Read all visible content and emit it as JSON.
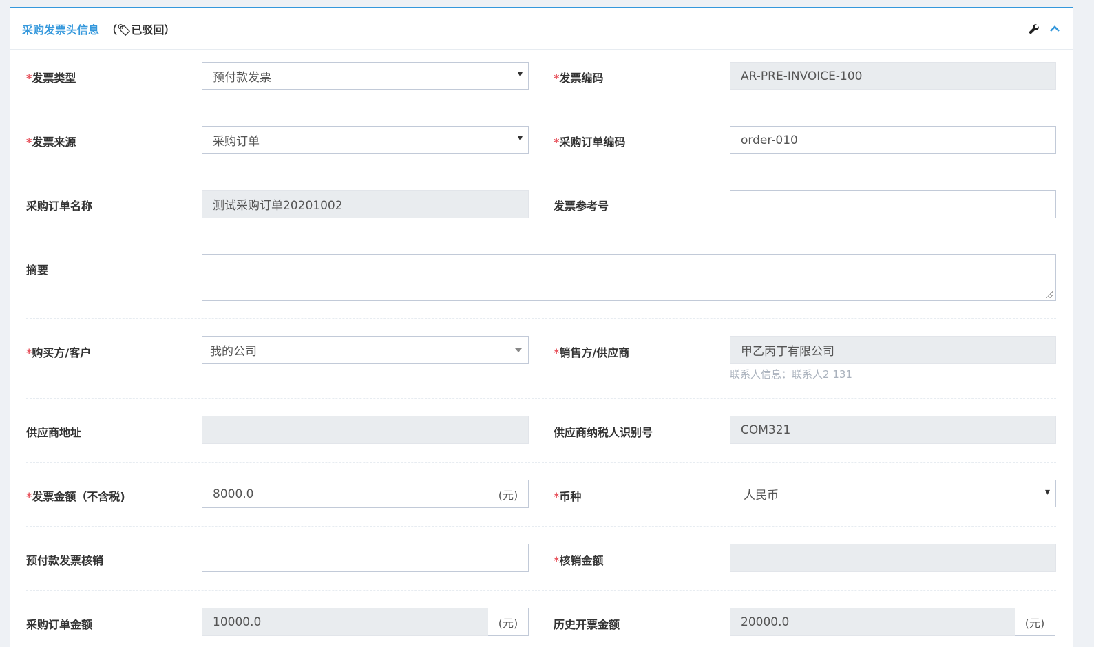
{
  "panel": {
    "title": "采购发票头信息",
    "status": "（🏷已驳回）",
    "wrench_icon": "wrench-icon",
    "collapse_icon": "chevron-up-icon",
    "accent": "#3598dc"
  },
  "fields": {
    "invoice_type": {
      "label": "发票类型",
      "value": "预付款发票"
    },
    "invoice_code": {
      "label": "发票编码",
      "value": "AR-PRE-INVOICE-100"
    },
    "invoice_source": {
      "label": "发票来源",
      "value": "采购订单"
    },
    "po_code": {
      "label": "采购订单编码",
      "value": "order-010"
    },
    "po_name": {
      "label": "采购订单名称",
      "value": "测试采购订单20201002"
    },
    "invoice_ref": {
      "label": "发票参考号",
      "value": ""
    },
    "summary": {
      "label": "摘要",
      "value": ""
    },
    "buyer": {
      "label": "购买方/客户",
      "value": "我的公司"
    },
    "seller": {
      "label": "销售方/供应商",
      "value": "甲乙丙丁有限公司",
      "help": "联系人信息：联系人2 131"
    },
    "supplier_address": {
      "label": "供应商地址",
      "value": ""
    },
    "supplier_tax_id": {
      "label": "供应商纳税人识别号",
      "value": "COM321"
    },
    "invoice_amount": {
      "label": "发票金额（不含税)",
      "value": "8000.0",
      "unit": "(元)"
    },
    "currency": {
      "label": "币种",
      "value": "人民币"
    },
    "prepay_writeoff": {
      "label": "预付款发票核销",
      "value": ""
    },
    "writeoff_amount": {
      "label": "核销金额",
      "value": ""
    },
    "po_amount": {
      "label": "采购订单金额",
      "value": "10000.0",
      "unit": "(元)"
    },
    "history_amount": {
      "label": "历史开票金额",
      "value": "20000.0",
      "unit": "(元)"
    }
  },
  "required_mark": "*"
}
